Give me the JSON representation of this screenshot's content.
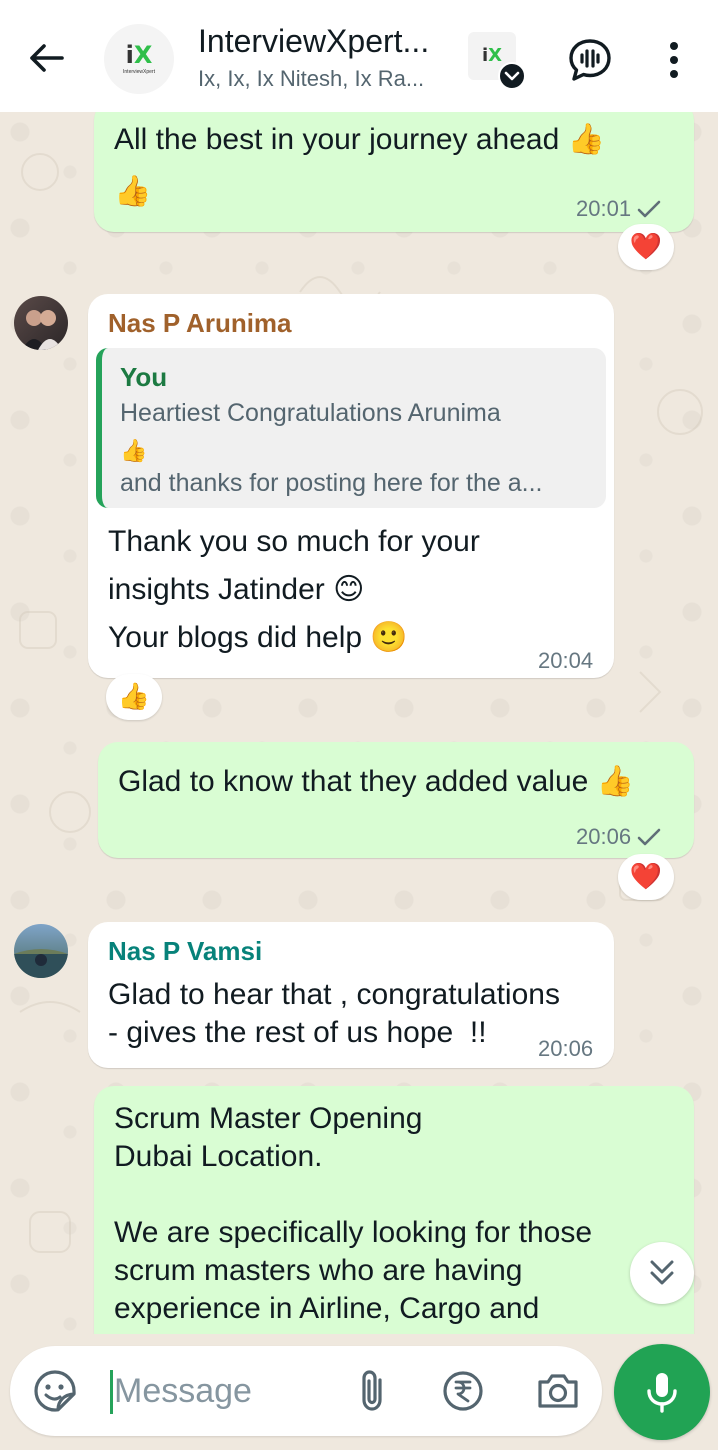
{
  "header": {
    "group_title": "InterviewXpert...",
    "group_members": "Ix, Ix, Ix Nitesh, Ix Ra...",
    "logo_text": "iX",
    "logo_subtext": "InterviewXpert"
  },
  "messages": [
    {
      "id": "m1",
      "direction": "out",
      "text": "All the best in your journey ahead 👍\n👍",
      "time": "20:01",
      "status": "sent",
      "reaction": "❤️"
    },
    {
      "id": "m2",
      "direction": "in",
      "sender": "Nas P Arunima",
      "sender_color": "#a0612b",
      "quote": {
        "author": "You",
        "line1": "Heartiest Congratulations Arunima",
        "line2": "👍",
        "line3": "and thanks for posting here for the a..."
      },
      "text": "Thank you so much for your\ninsights Jatinder 😊\nYour blogs did help 🙂",
      "time": "20:04",
      "reaction": "👍"
    },
    {
      "id": "m3",
      "direction": "out",
      "text": "Glad to know that they added value 👍",
      "time": "20:06",
      "status": "sent",
      "reaction": "❤️"
    },
    {
      "id": "m4",
      "direction": "in",
      "sender": "Nas P Vamsi",
      "sender_color": "#07827a",
      "text": "Glad to hear that , congratulations\n- gives the rest of us hope  !!",
      "time": "20:06"
    },
    {
      "id": "m5",
      "direction": "out",
      "text": "Scrum Master Opening\nDubai Location.\n\nWe are specifically looking for those\nscrum masters who are having\nexperience in Airline, Cargo and"
    }
  ],
  "composer": {
    "placeholder": "Message"
  },
  "colors": {
    "outgoing_bubble": "#d9fdd3",
    "incoming_bubble": "#ffffff",
    "accent_green": "#21a354",
    "wallpaper": "#efe8de"
  },
  "icons": [
    "back-arrow-icon",
    "chevron-down-icon",
    "voice-chat-icon",
    "more-vert-icon",
    "check-icon",
    "sticker-icon",
    "attach-icon",
    "rupee-icon",
    "camera-icon",
    "mic-icon",
    "double-chevron-down-icon"
  ]
}
